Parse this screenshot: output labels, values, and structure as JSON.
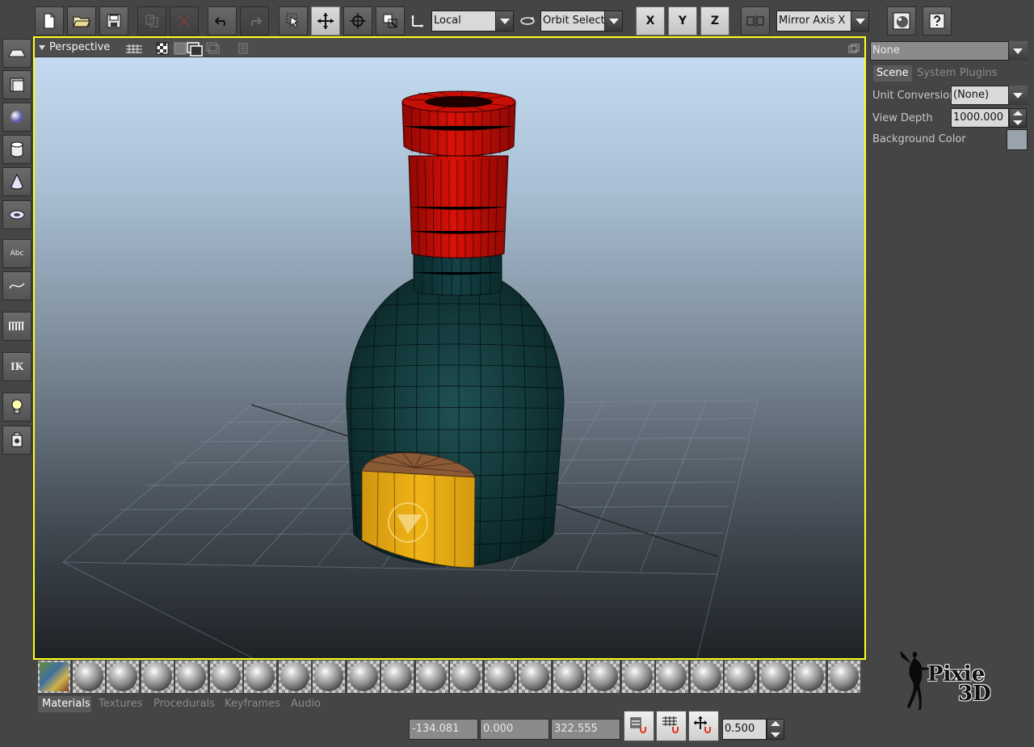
{
  "toolbar": {
    "coordinate_space": "Local",
    "camera_mode": "Orbit Selecte",
    "axis_x": "X",
    "axis_y": "Y",
    "axis_z": "Z",
    "mirror_axis": "Mirror Axis X"
  },
  "left_tools": {
    "text_tool": "Abc",
    "ik_tool": "IK"
  },
  "viewport": {
    "title": "Perspective"
  },
  "right_panel": {
    "object_select": "None",
    "tabs": [
      "Scene",
      "System",
      "Plugins"
    ],
    "active_tab": "Scene",
    "unit_conversion_label": "Unit Conversion",
    "unit_conversion_value": "(None)",
    "view_depth_label": "View Depth",
    "view_depth_value": "1000.000",
    "background_color_label": "Background Color",
    "background_color": "#9aa3ab"
  },
  "library_tabs": [
    "Materials",
    "Textures",
    "Procedurals",
    "Keyframes",
    "Audio"
  ],
  "active_library_tab": "Materials",
  "status_bar": {
    "x": "-134.081",
    "y": "0.000",
    "z": "322.555",
    "snap_value": "0.500"
  },
  "logo": {
    "line1": "Pixie",
    "line2": "3D"
  },
  "colors": {
    "viewport_border": "#ffff1a",
    "bottle_cap": "#c40c06",
    "bottle_body": "#10383a",
    "label": "#e6a80e"
  }
}
